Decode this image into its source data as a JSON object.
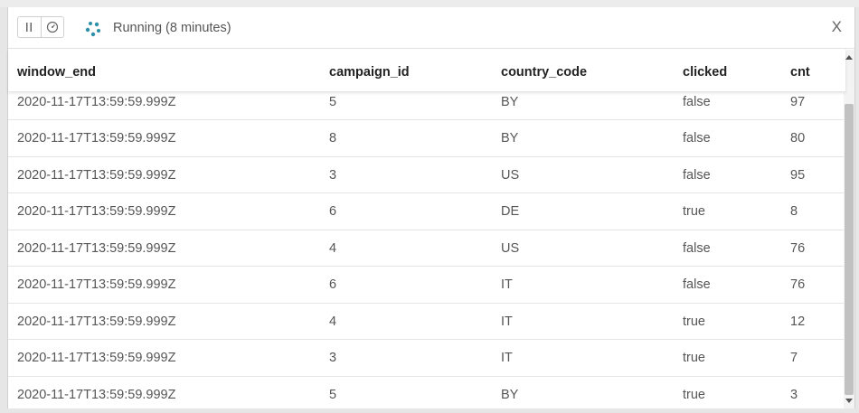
{
  "status": {
    "text": "Running (8 minutes)"
  },
  "toolbar": {
    "pause_icon": "pause-icon",
    "gauge_icon": "gauge-icon",
    "close_label": "X"
  },
  "table": {
    "columns": [
      "window_end",
      "campaign_id",
      "country_code",
      "clicked",
      "cnt"
    ],
    "rows": [
      [
        "2020-11-17T13:59:59.999Z",
        "5",
        "BY",
        "false",
        "97"
      ],
      [
        "2020-11-17T13:59:59.999Z",
        "8",
        "BY",
        "false",
        "80"
      ],
      [
        "2020-11-17T13:59:59.999Z",
        "3",
        "US",
        "false",
        "95"
      ],
      [
        "2020-11-17T13:59:59.999Z",
        "6",
        "DE",
        "true",
        "8"
      ],
      [
        "2020-11-17T13:59:59.999Z",
        "4",
        "US",
        "false",
        "76"
      ],
      [
        "2020-11-17T13:59:59.999Z",
        "6",
        "IT",
        "false",
        "76"
      ],
      [
        "2020-11-17T13:59:59.999Z",
        "4",
        "IT",
        "true",
        "12"
      ],
      [
        "2020-11-17T13:59:59.999Z",
        "3",
        "IT",
        "true",
        "7"
      ],
      [
        "2020-11-17T13:59:59.999Z",
        "5",
        "BY",
        "true",
        "3"
      ]
    ]
  },
  "colors": {
    "spinner": "#2e8fa8"
  }
}
